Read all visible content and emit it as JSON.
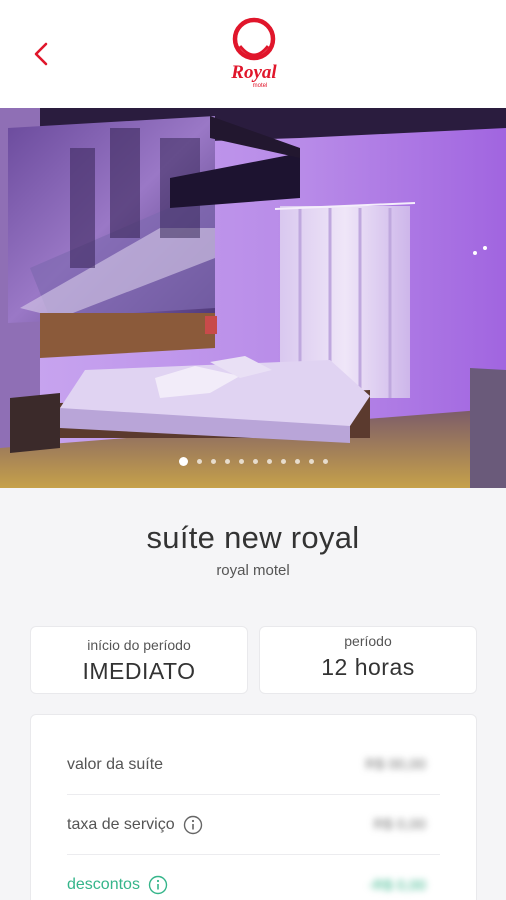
{
  "header": {
    "back_icon": "chevron-left-icon",
    "logo_text": "Royal",
    "logo_subtext": "motel",
    "accent_color": "#e0162b"
  },
  "gallery": {
    "slide_count": 11,
    "active_index": 0
  },
  "suite": {
    "name": "suíte new royal",
    "motel": "royal motel"
  },
  "period_start": {
    "label": "início do período",
    "value": "IMEDIATO"
  },
  "period": {
    "label": "período",
    "value": "12 horas"
  },
  "pricing": {
    "rows": [
      {
        "label": "valor da suíte",
        "value": "R$ 00,00",
        "info": false
      },
      {
        "label": "taxa de serviço",
        "value": "R$ 0,00",
        "info": true
      },
      {
        "label": "descontos",
        "value": "-R$ 0,00",
        "info": true,
        "color": "#35b58a"
      }
    ]
  }
}
